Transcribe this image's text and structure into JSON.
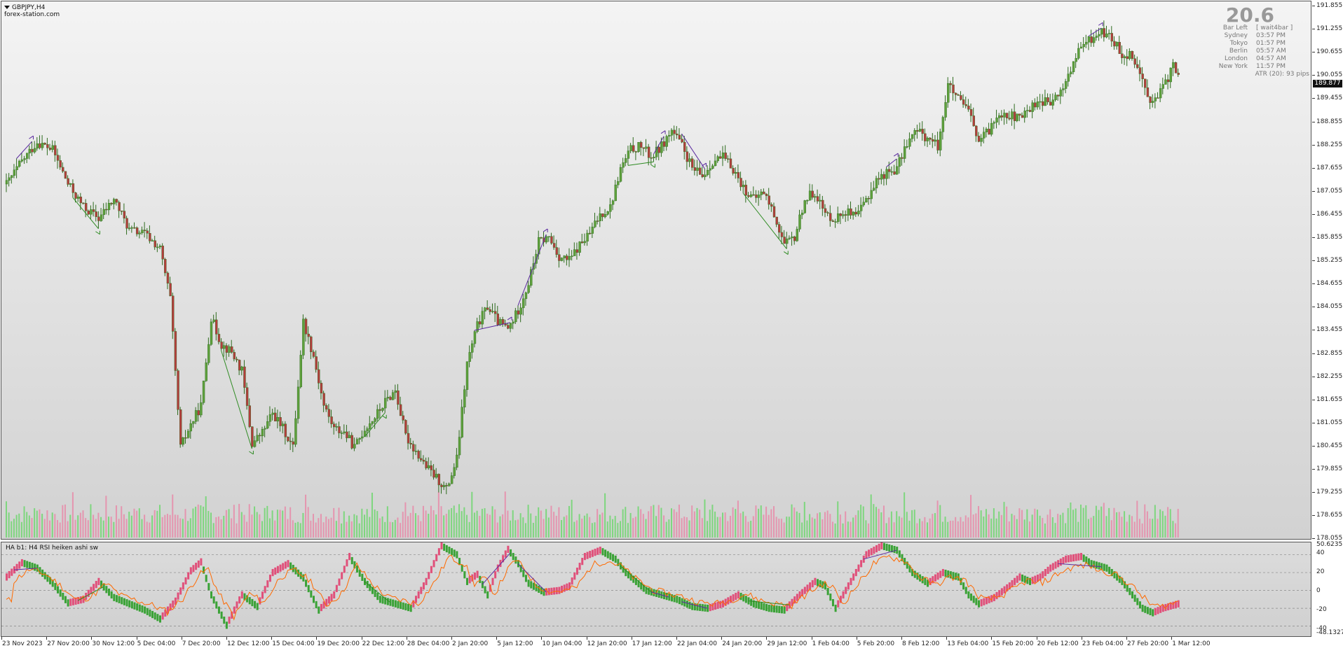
{
  "chart": {
    "symbol_title": "GBPJPY,H4",
    "site": "forex-station.com",
    "indicator_title": "HA b1: H4 RSI heiken ashi sw",
    "big_number": "20.6",
    "current_price": "189.877"
  },
  "info": [
    {
      "label": "Bar Left",
      "value": "[ wait4bar ]"
    },
    {
      "label": "Sydney",
      "value": "03:57 PM"
    },
    {
      "label": "Tokyo",
      "value": "01:57 PM"
    },
    {
      "label": "Berlin",
      "value": "05:57 AM"
    },
    {
      "label": "London",
      "value": "04:57 AM"
    },
    {
      "label": "New York",
      "value": "11:57 PM"
    }
  ],
  "atr": "ATR (20): 93 pips",
  "price_axis": [
    "191.855",
    "191.255",
    "190.655",
    "190.055",
    "189.455",
    "188.855",
    "188.255",
    "187.655",
    "187.055",
    "186.455",
    "185.855",
    "185.255",
    "184.655",
    "184.055",
    "183.455",
    "182.855",
    "182.255",
    "181.655",
    "181.055",
    "180.455",
    "179.855",
    "179.255",
    "178.655",
    "178.055"
  ],
  "ind_axis": [
    "50.6235",
    "40",
    "20",
    "0",
    "-20",
    "-40",
    "-48.1327"
  ],
  "time_axis": [
    "23 Nov 2023",
    "27 Nov 20:00",
    "30 Nov 12:00",
    "5 Dec 04:00",
    "7 Dec 20:00",
    "12 Dec 12:00",
    "15 Dec 04:00",
    "19 Dec 20:00",
    "22 Dec 12:00",
    "28 Dec 04:00",
    "2 Jan 20:00",
    "5 Jan 12:00",
    "10 Jan 04:00",
    "12 Jan 20:00",
    "17 Jan 12:00",
    "22 Jan 04:00",
    "24 Jan 20:00",
    "29 Jan 12:00",
    "1 Feb 04:00",
    "5 Feb 20:00",
    "8 Feb 12:00",
    "13 Feb 04:00",
    "15 Feb 20:00",
    "20 Feb 12:00",
    "23 Feb 04:00",
    "27 Feb 20:00",
    "1 Mar 12:00"
  ],
  "colors": {
    "bull": "#3aa236",
    "bear": "#e0507a",
    "candle_bull_body": "#5ea03c",
    "candle_bear_body": "#b43c3c",
    "wick": "#2e6b1e",
    "rsi_line": "#ff6a00",
    "divergence_bear": "#5b2aa0",
    "divergence_bull": "#2e8b22",
    "vol_green": "#6ed66e",
    "vol_pink": "#e88aa8"
  },
  "chart_data": {
    "type": "candlestick",
    "ylim": [
      178.055,
      191.855
    ],
    "anchors": [
      [
        0,
        187.2
      ],
      [
        6,
        187.8
      ],
      [
        12,
        188.3
      ],
      [
        18,
        188.1
      ],
      [
        24,
        187.2
      ],
      [
        30,
        186.6
      ],
      [
        36,
        186.3
      ],
      [
        42,
        186.8
      ],
      [
        48,
        186.0
      ],
      [
        54,
        185.9
      ],
      [
        60,
        185.5
      ],
      [
        64,
        184.2
      ],
      [
        68,
        180.3
      ],
      [
        72,
        180.9
      ],
      [
        76,
        181.4
      ],
      [
        80,
        183.7
      ],
      [
        84,
        183.0
      ],
      [
        88,
        182.8
      ],
      [
        92,
        182.3
      ],
      [
        96,
        180.4
      ],
      [
        100,
        180.7
      ],
      [
        104,
        181.2
      ],
      [
        108,
        180.8
      ],
      [
        112,
        180.3
      ],
      [
        116,
        183.6
      ],
      [
        120,
        182.7
      ],
      [
        124,
        181.4
      ],
      [
        128,
        180.8
      ],
      [
        132,
        180.7
      ],
      [
        136,
        180.3
      ],
      [
        140,
        180.8
      ],
      [
        144,
        181.1
      ],
      [
        148,
        181.5
      ],
      [
        152,
        181.8
      ],
      [
        156,
        180.6
      ],
      [
        160,
        180.2
      ],
      [
        164,
        179.8
      ],
      [
        168,
        179.5
      ],
      [
        172,
        179.2
      ],
      [
        176,
        180.0
      ],
      [
        180,
        182.5
      ],
      [
        184,
        183.5
      ],
      [
        188,
        184.0
      ],
      [
        192,
        183.6
      ],
      [
        196,
        183.4
      ],
      [
        200,
        183.9
      ],
      [
        204,
        184.6
      ],
      [
        208,
        185.7
      ],
      [
        212,
        185.8
      ],
      [
        216,
        185.3
      ],
      [
        220,
        185.2
      ],
      [
        224,
        185.6
      ],
      [
        228,
        185.9
      ],
      [
        232,
        186.4
      ],
      [
        236,
        186.6
      ],
      [
        240,
        187.6
      ],
      [
        244,
        188.1
      ],
      [
        248,
        188.2
      ],
      [
        252,
        187.9
      ],
      [
        256,
        188.2
      ],
      [
        260,
        188.6
      ],
      [
        264,
        188.2
      ],
      [
        268,
        187.6
      ],
      [
        272,
        187.4
      ],
      [
        276,
        187.8
      ],
      [
        280,
        187.9
      ],
      [
        284,
        187.6
      ],
      [
        288,
        187.1
      ],
      [
        292,
        186.8
      ],
      [
        296,
        187.0
      ],
      [
        300,
        186.4
      ],
      [
        304,
        185.6
      ],
      [
        308,
        185.8
      ],
      [
        312,
        186.8
      ],
      [
        316,
        187.0
      ],
      [
        320,
        186.4
      ],
      [
        324,
        186.3
      ],
      [
        328,
        186.5
      ],
      [
        332,
        186.3
      ],
      [
        336,
        186.8
      ],
      [
        340,
        187.3
      ],
      [
        344,
        187.5
      ],
      [
        348,
        187.6
      ],
      [
        352,
        188.3
      ],
      [
        356,
        188.6
      ],
      [
        360,
        188.4
      ],
      [
        364,
        188.2
      ],
      [
        368,
        189.8
      ],
      [
        372,
        189.4
      ],
      [
        376,
        189.1
      ],
      [
        380,
        188.3
      ],
      [
        384,
        188.6
      ],
      [
        388,
        189.1
      ],
      [
        392,
        189.0
      ],
      [
        396,
        188.9
      ],
      [
        400,
        189.2
      ],
      [
        404,
        189.4
      ],
      [
        408,
        189.3
      ],
      [
        412,
        189.6
      ],
      [
        416,
        190.2
      ],
      [
        420,
        190.8
      ],
      [
        424,
        191.0
      ],
      [
        428,
        191.2
      ],
      [
        432,
        191.0
      ],
      [
        436,
        190.6
      ],
      [
        440,
        190.6
      ],
      [
        444,
        189.9
      ],
      [
        448,
        189.3
      ],
      [
        452,
        189.7
      ],
      [
        456,
        190.3
      ],
      [
        458,
        190.0
      ]
    ],
    "rsi_anchors": [
      [
        0,
        15
      ],
      [
        6,
        31
      ],
      [
        12,
        25
      ],
      [
        18,
        8
      ],
      [
        24,
        -14
      ],
      [
        30,
        -10
      ],
      [
        36,
        10
      ],
      [
        42,
        -8
      ],
      [
        48,
        -15
      ],
      [
        54,
        -22
      ],
      [
        60,
        -32
      ],
      [
        66,
        -12
      ],
      [
        72,
        22
      ],
      [
        76,
        32
      ],
      [
        80,
        -5
      ],
      [
        86,
        -39
      ],
      [
        92,
        -5
      ],
      [
        98,
        -18
      ],
      [
        104,
        20
      ],
      [
        110,
        30
      ],
      [
        116,
        14
      ],
      [
        122,
        -22
      ],
      [
        128,
        -5
      ],
      [
        134,
        38
      ],
      [
        140,
        10
      ],
      [
        146,
        -10
      ],
      [
        152,
        -15
      ],
      [
        158,
        -20
      ],
      [
        164,
        10
      ],
      [
        170,
        50
      ],
      [
        176,
        40
      ],
      [
        180,
        10
      ],
      [
        184,
        18
      ],
      [
        188,
        -5
      ],
      [
        192,
        25
      ],
      [
        196,
        46
      ],
      [
        200,
        30
      ],
      [
        204,
        8
      ],
      [
        210,
        -2
      ],
      [
        216,
        0
      ],
      [
        220,
        5
      ],
      [
        226,
        38
      ],
      [
        232,
        45
      ],
      [
        238,
        35
      ],
      [
        242,
        20
      ],
      [
        246,
        10
      ],
      [
        250,
        0
      ],
      [
        256,
        -5
      ],
      [
        262,
        -10
      ],
      [
        268,
        -18
      ],
      [
        274,
        -20
      ],
      [
        280,
        -15
      ],
      [
        286,
        -5
      ],
      [
        292,
        -15
      ],
      [
        298,
        -20
      ],
      [
        304,
        -22
      ],
      [
        310,
        -5
      ],
      [
        316,
        10
      ],
      [
        320,
        5
      ],
      [
        324,
        -20
      ],
      [
        330,
        10
      ],
      [
        336,
        40
      ],
      [
        342,
        50
      ],
      [
        348,
        45
      ],
      [
        354,
        20
      ],
      [
        360,
        8
      ],
      [
        366,
        20
      ],
      [
        372,
        15
      ],
      [
        376,
        -5
      ],
      [
        380,
        -15
      ],
      [
        386,
        -8
      ],
      [
        392,
        5
      ],
      [
        396,
        15
      ],
      [
        400,
        10
      ],
      [
        404,
        15
      ],
      [
        408,
        25
      ],
      [
        414,
        35
      ],
      [
        420,
        38
      ],
      [
        424,
        30
      ],
      [
        430,
        25
      ],
      [
        436,
        10
      ],
      [
        440,
        -5
      ],
      [
        444,
        -20
      ],
      [
        448,
        -25
      ],
      [
        452,
        -20
      ],
      [
        458,
        -15
      ]
    ]
  }
}
